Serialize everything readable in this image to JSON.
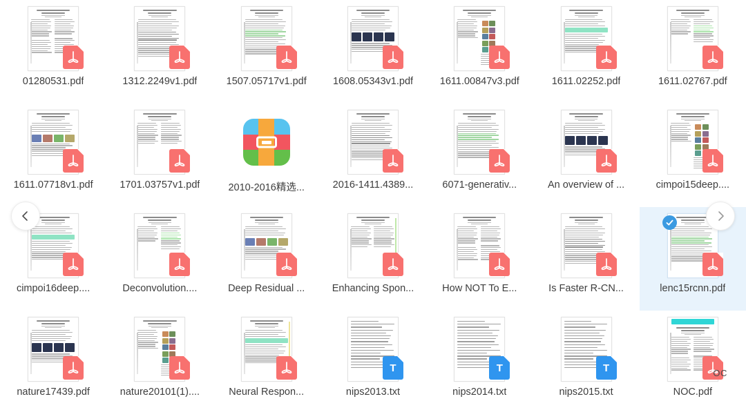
{
  "view": {
    "type": "file-grid",
    "columns": 7,
    "rows": 4,
    "background": "#ffffff",
    "selection_highlight_color": "#e8f3fc",
    "selection_check_color": "#3b9ae1",
    "label_color": "#3d3d3d"
  },
  "nav": {
    "prev_label": "‹",
    "next_label": "›",
    "prev_name": "previous-page",
    "next_name": "next-page"
  },
  "icons": {
    "pdf_glyph": "ʕ",
    "txt_glyph": "T",
    "pdf_color": "#f8716f",
    "txt_color": "#2f95ef",
    "folder_name": "folder-icon"
  },
  "overlays": {
    "noc_watermark": "OC"
  },
  "files": [
    {
      "name": "01280531.pdf",
      "type": "pdf",
      "selected": false
    },
    {
      "name": "1312.2249v1.pdf",
      "type": "pdf",
      "selected": false
    },
    {
      "name": "1507.05717v1.pdf",
      "type": "pdf",
      "selected": false
    },
    {
      "name": "1608.05343v1.pdf",
      "type": "pdf",
      "selected": false
    },
    {
      "name": "1611.00847v3.pdf",
      "type": "pdf",
      "selected": false
    },
    {
      "name": "1611.02252.pdf",
      "type": "pdf",
      "selected": false
    },
    {
      "name": "1611.02767.pdf",
      "type": "pdf",
      "selected": false
    },
    {
      "name": "1611.07718v1.pdf",
      "type": "pdf",
      "selected": false
    },
    {
      "name": "1701.03757v1.pdf",
      "type": "pdf",
      "selected": false
    },
    {
      "name": "2010-2016精选...",
      "type": "folder",
      "selected": false
    },
    {
      "name": "2016-1411.4389...",
      "type": "pdf",
      "selected": false
    },
    {
      "name": "6071-generativ...",
      "type": "pdf",
      "selected": false
    },
    {
      "name": "An overview of ...",
      "type": "pdf",
      "selected": false
    },
    {
      "name": "cimpoi15deep....",
      "type": "pdf",
      "selected": false
    },
    {
      "name": "cimpoi16deep....",
      "type": "pdf",
      "selected": false
    },
    {
      "name": "Deconvolution....",
      "type": "pdf",
      "selected": false
    },
    {
      "name": "Deep Residual ...",
      "type": "pdf",
      "selected": false
    },
    {
      "name": "Enhancing Spon...",
      "type": "pdf",
      "selected": false
    },
    {
      "name": "How NOT To E...",
      "type": "pdf",
      "selected": false
    },
    {
      "name": "Is Faster R-CN...",
      "type": "pdf",
      "selected": false
    },
    {
      "name": "lenc15rcnn.pdf",
      "type": "pdf",
      "selected": true
    },
    {
      "name": "nature17439.pdf",
      "type": "pdf",
      "selected": false
    },
    {
      "name": "nature20101(1)....",
      "type": "pdf",
      "selected": false
    },
    {
      "name": "Neural Respon...",
      "type": "pdf",
      "selected": false
    },
    {
      "name": "nips2013.txt",
      "type": "txt",
      "selected": false
    },
    {
      "name": "nips2014.txt",
      "type": "txt",
      "selected": false
    },
    {
      "name": "nips2015.txt",
      "type": "txt",
      "selected": false
    },
    {
      "name": "NOC.pdf",
      "type": "pdf",
      "selected": false
    }
  ]
}
